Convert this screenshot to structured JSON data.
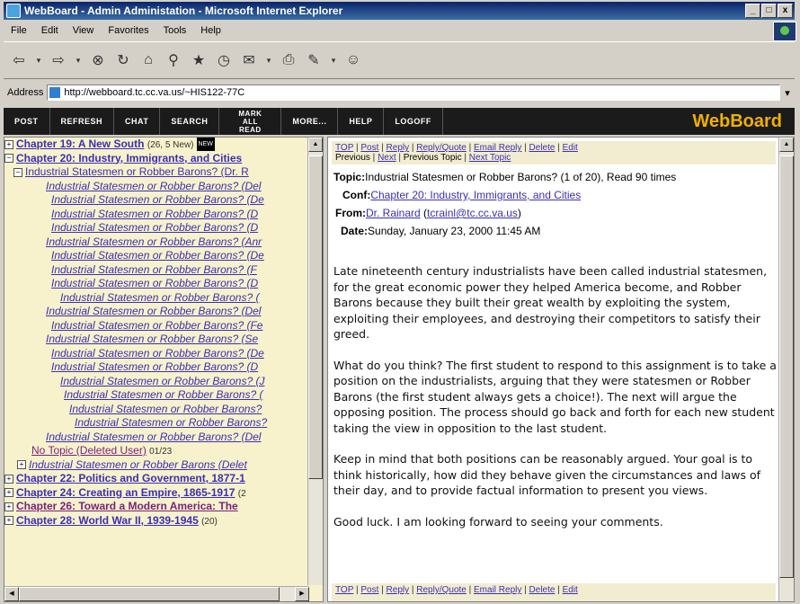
{
  "window": {
    "title": "WebBoard - Admin Administation - Microsoft Internet Explorer",
    "controls": [
      "_",
      "□",
      "x"
    ]
  },
  "menu": [
    "File",
    "Edit",
    "View",
    "Favorites",
    "Tools",
    "Help"
  ],
  "address": {
    "label": "Address",
    "url": "http://webboard.tc.cc.va.us/~HIS122-77C"
  },
  "nav": [
    "POST",
    "REFRESH",
    "CHAT",
    "SEARCH",
    "MARK ALL READ",
    "MORE...",
    "HELP",
    "LOGOFF"
  ],
  "brand": "WebBoard",
  "tree": {
    "chapter19": {
      "label": "Chapter 19: A New South",
      "count": "(26, 5 New)",
      "badge": "NEW"
    },
    "chapter20": {
      "label": "Chapter 20: Industry, Immigrants, and Cities"
    },
    "thread": {
      "label": "Industrial Statesmen or Robber Barons? (Dr. R"
    },
    "replies": [
      "Industrial Statesmen or Robber Barons? (Del",
      "Industrial Statesmen or Robber Barons? (De",
      "Industrial Statesmen or Robber Barons? (D",
      "Industrial Statesmen or Robber Barons? (D",
      "Industrial Statesmen or Robber Barons? (Anr",
      "Industrial Statesmen or Robber Barons? (De",
      "Industrial Statesmen or Robber Barons? (F",
      "Industrial Statesmen or Robber Barons? (D",
      "Industrial Statesmen or Robber Barons? (",
      "Industrial Statesmen or Robber Barons? (Del",
      "Industrial Statesmen or Robber Barons? (Fe",
      "Industrial Statesmen or Robber Barons? (Se",
      "Industrial Statesmen or Robber Barons? (De",
      "Industrial Statesmen or Robber Barons? (D",
      "Industrial Statesmen or Robber Barons? (J",
      "Industrial Statesmen or Robber Barons? (",
      "Industrial Statesmen or Robber Barons?",
      "Industrial Statesmen or Robber Barons?",
      "Industrial Statesmen or Robber Barons? (Del"
    ],
    "notopic": {
      "label": "No Topic (Deleted User)",
      "date": "01/23"
    },
    "deleted": {
      "label": "Industrial Statesmen or Robber Barons (Delet"
    },
    "chapter22": {
      "label": "Chapter 22: Politics and Government, 1877-1"
    },
    "chapter24": {
      "label": "Chapter 24: Creating an Empire, 1865-1917",
      "count": "(2"
    },
    "chapter26": {
      "label": "Chapter 26: Toward a Modern America: The"
    },
    "chapter28": {
      "label": "Chapter 28: World War II, 1939-1945",
      "count": "(20)"
    }
  },
  "msgbar": {
    "top": "TOP",
    "post": "Post",
    "reply": "Reply",
    "replyquote": "Reply/Quote",
    "email": "Email Reply",
    "delete": "Delete",
    "edit": "Edit",
    "previous": "Previous",
    "next": "Next",
    "prevtopic": "Previous Topic",
    "nexttopic": "Next Topic"
  },
  "message": {
    "topic_label": "Topic:",
    "topic": "Industrial Statesmen or Robber Barons? (1 of 20), Read 90 times",
    "conf_label": "Conf:",
    "conf": "Chapter 20: Industry, Immigrants, and Cities",
    "from_label": "From:",
    "from_name": "Dr. Rainard",
    "from_email": "tcrainl@tc.cc.va.us",
    "date_label": "Date:",
    "date": "Sunday, January 23, 2000 11:45 AM",
    "paragraphs": [
      "Late nineteenth century industrialists have been called industrial statesmen, for the great economic power they helped America become, and Robber Barons because they built their great wealth by exploiting the system, exploiting their employees, and destroying their competitors to satisfy their greed.",
      "What do you think? The first student to respond to this assignment is to take a position on the industrialists, arguing that they were statesmen or Robber Barons (the first student always gets a choice!). The next will argue the opposing position. The process should go back and forth for each new student taking the view in opposition to the last student.",
      "Keep in mind that both positions can be reasonably argued. Your goal is to think historically, how did they behave given the circumstances and laws of their day, and to provide factual information to present you views.",
      "Good luck. I am looking forward to seeing your comments."
    ]
  }
}
